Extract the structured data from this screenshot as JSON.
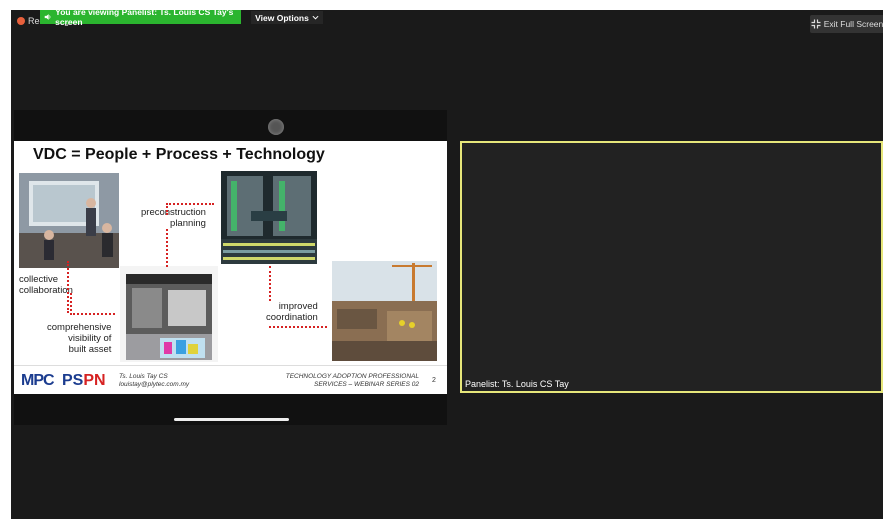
{
  "recording": {
    "label": "Recording"
  },
  "banner": {
    "text": "You are viewing Panelist: Ts. Louis CS Tay's screen"
  },
  "view_options": {
    "label": "View Options",
    "chevron": "chevron-down-icon"
  },
  "exit_fullscreen": {
    "label": "Exit Full Screen",
    "icon": "exit-fullscreen-icon"
  },
  "slide": {
    "title": "VDC = People + Process + Technology",
    "labels": {
      "collaboration": [
        "collective",
        "collaboration"
      ],
      "visibility": [
        "comprehensive",
        "visibility of",
        "built asset"
      ],
      "preconstruction": [
        "preconstruction",
        "planning"
      ],
      "coordination": [
        "improved",
        "coordination"
      ]
    },
    "footer": {
      "logo_left": "MPC",
      "logo_right_parts": [
        "PS",
        "PN"
      ],
      "presenter_name": "Ts. Louis Tay CS",
      "presenter_email": "louistay@plytec.com.my",
      "series_line1": "TECHNOLOGY ADOPTION PROFESSIONAL",
      "series_line2": "SERVICES – WEBINAR SERIES 02",
      "page_number": "2"
    }
  },
  "panelist": {
    "name": "Panelist: Ts. Louis CS Tay"
  },
  "colors": {
    "banner": "#2bb52f",
    "panel_border": "#e6e67a",
    "accent_red": "#d62222"
  }
}
